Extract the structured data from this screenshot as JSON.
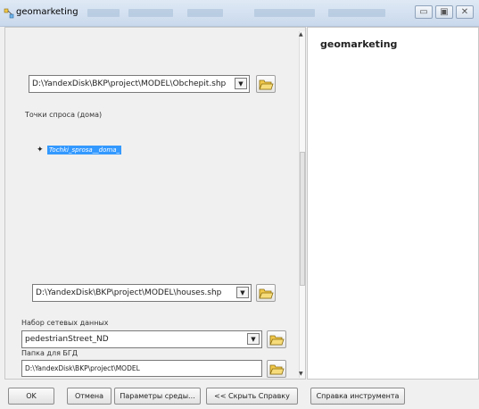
{
  "window": {
    "title": "geomarketing"
  },
  "form": {
    "input_path": "D:\\YandexDisk\\BKP\\project\\MODEL\\Obchepit.shp",
    "demand_label": "Точки спроса (дома)",
    "layer_item": "Tochki_sprosa__doma_",
    "houses_path": "D:\\YandexDisk\\BKP\\project\\MODEL\\houses.shp",
    "network_label": "Набор сетевых данных",
    "network_value": "pedestrianStreet_ND",
    "gdb_label": "Папка для БГД",
    "gdb_path": "D:\\YandexDisk\\BKP\\project\\MODEL"
  },
  "help": {
    "title": "geomarketing"
  },
  "buttons": {
    "ok": "OK",
    "cancel": "Отмена",
    "env": "Параметры среды...",
    "hide_help": "<< Скрыть Справку",
    "tool_help": "Справка инструмента"
  },
  "icons": {
    "app": "model-icon",
    "folder": "open-folder-icon",
    "dropdown": "dropdown-arrow-icon"
  },
  "colors": {
    "selection": "#3399ff",
    "folder": "#f2c84b"
  }
}
